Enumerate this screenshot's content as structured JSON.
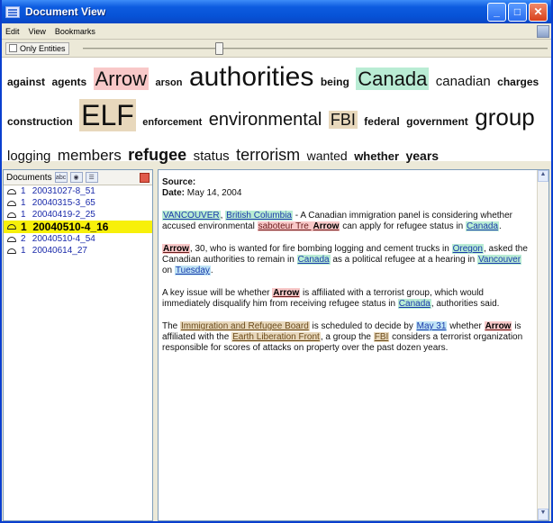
{
  "window": {
    "title": "Document View"
  },
  "menu": [
    "Edit",
    "View",
    "Bookmarks"
  ],
  "filter": {
    "only_entities_label": "Only Entities"
  },
  "cloud": [
    {
      "text": "against",
      "size": 12
    },
    {
      "text": "agents",
      "size": 12
    },
    {
      "text": "Arrow",
      "size": 22,
      "bg": "#f8c8c8",
      "weight": "normal"
    },
    {
      "text": "arson",
      "size": 11
    },
    {
      "text": "authorities",
      "size": 30,
      "weight": "normal"
    },
    {
      "text": "being",
      "size": 12
    },
    {
      "text": "Canada",
      "size": 22,
      "bg": "#b9ecd4",
      "weight": "normal"
    },
    {
      "text": "canadian",
      "size": 15,
      "weight": "normal"
    },
    {
      "text": "charges",
      "size": 12
    },
    {
      "text": "construction",
      "size": 12
    },
    {
      "text": "ELF",
      "size": 32,
      "bg": "#e8d8bc",
      "weight": "normal"
    },
    {
      "text": "enforcement",
      "size": 11
    },
    {
      "text": "environmental",
      "size": 20,
      "weight": "normal"
    },
    {
      "text": "FBI",
      "size": 18,
      "bg": "#e8d8bc",
      "weight": "normal"
    },
    {
      "text": "federal",
      "size": 12
    },
    {
      "text": "government",
      "size": 12
    },
    {
      "text": "group",
      "size": 26,
      "weight": "normal"
    },
    {
      "text": "logging",
      "size": 15,
      "weight": "normal"
    },
    {
      "text": "members",
      "size": 17,
      "weight": "normal"
    },
    {
      "text": "refugee",
      "size": 18
    },
    {
      "text": "status",
      "size": 15,
      "weight": "normal"
    },
    {
      "text": "terrorism",
      "size": 18,
      "weight": "normal"
    },
    {
      "text": "wanted",
      "size": 14,
      "weight": "normal"
    },
    {
      "text": "whether",
      "size": 13
    },
    {
      "text": "years",
      "size": 14
    }
  ],
  "documents": {
    "header": "Documents",
    "items": [
      {
        "count": "1",
        "id": "20031027-8_51",
        "selected": false
      },
      {
        "count": "1",
        "id": "20040315-3_65",
        "selected": false
      },
      {
        "count": "1",
        "id": "20040419-2_25",
        "selected": false
      },
      {
        "count": "1",
        "id": "20040510-4_16",
        "selected": true
      },
      {
        "count": "2",
        "id": "20040510-4_54",
        "selected": false
      },
      {
        "count": "1",
        "id": "20040614_27",
        "selected": false
      }
    ]
  },
  "article": {
    "source_label": "Source:",
    "date_label": "Date:",
    "date_value": "May 14, 2004",
    "paragraphs": [
      [
        {
          "t": "VANCOUVER",
          "e": "loc"
        },
        {
          "t": ", "
        },
        {
          "t": "British Columbia",
          "e": "loc"
        },
        {
          "t": " - A Canadian immigration panel is considering whether accused environmental "
        },
        {
          "t": "saboteur Tre ",
          "e": "per"
        },
        {
          "t": "Arrow",
          "e": "per",
          "b": true
        },
        {
          "t": " can apply for refugee status in "
        },
        {
          "t": "Canada",
          "e": "loc"
        },
        {
          "t": "."
        }
      ],
      [
        {
          "t": "Arrow",
          "e": "per",
          "b": true
        },
        {
          "t": ", 30, who is wanted for fire bombing logging and cement trucks in "
        },
        {
          "t": "Oregon",
          "e": "loc"
        },
        {
          "t": ", asked the Canadian authorities to remain in "
        },
        {
          "t": "Canada",
          "e": "loc"
        },
        {
          "t": " as a political refugee at a hearing in "
        },
        {
          "t": "Vancouver",
          "e": "loc"
        },
        {
          "t": " on "
        },
        {
          "t": "Tuesday",
          "e": "date"
        },
        {
          "t": "."
        }
      ],
      [
        {
          "t": "A key issue will be whether "
        },
        {
          "t": "Arrow",
          "e": "per",
          "b": true
        },
        {
          "t": " is affiliated with a terrorist group, which would immediately disqualify him from receiving refugee status in "
        },
        {
          "t": "Canada",
          "e": "loc"
        },
        {
          "t": ", authorities said."
        }
      ],
      [
        {
          "t": "The "
        },
        {
          "t": "Immigration and Refugee Board",
          "e": "org"
        },
        {
          "t": " is scheduled to decide by "
        },
        {
          "t": "May 31",
          "e": "date"
        },
        {
          "t": " whether "
        },
        {
          "t": "Arrow",
          "e": "per",
          "b": true
        },
        {
          "t": " is affiliated with the "
        },
        {
          "t": "Earth Liberation Front",
          "e": "org"
        },
        {
          "t": ", a group the "
        },
        {
          "t": "FBI",
          "e": "org"
        },
        {
          "t": " considers a terrorist organization responsible for scores of attacks on property over the past dozen years."
        }
      ]
    ]
  },
  "colors": {
    "titlebar": "#0752d6",
    "selected_row": "#f7f00a",
    "location": "#b9ecd4",
    "person": "#f8c8c8",
    "organization": "#e8d8bc",
    "date": "#bfe3f5"
  }
}
